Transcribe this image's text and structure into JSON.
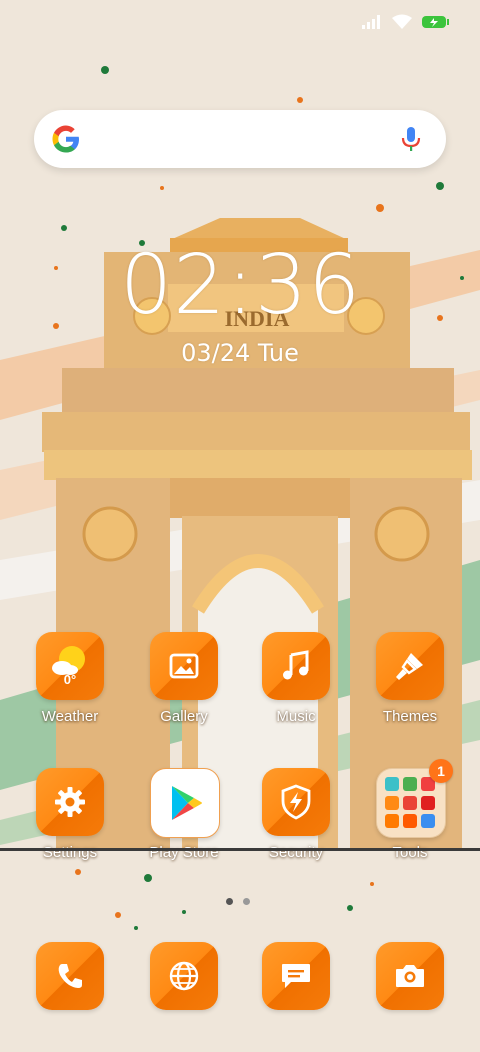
{
  "wallpaper": {
    "monument_text": "INDIA"
  },
  "status_bar": {
    "signal_icon": "signal-icon",
    "wifi_icon": "wifi-icon",
    "battery_icon": "battery-charging-icon",
    "battery_color": "#3cc43c"
  },
  "search": {
    "logo_icon": "google-g-icon",
    "mic_icon": "microphone-icon"
  },
  "clock": {
    "time": "02:36",
    "date": "03/24 Tue"
  },
  "apps_row1": [
    {
      "label": "Weather",
      "icon": "weather-sun-cloud-icon",
      "temp": "0°"
    },
    {
      "label": "Gallery",
      "icon": "gallery-image-icon"
    },
    {
      "label": "Music",
      "icon": "music-note-icon"
    },
    {
      "label": "Themes",
      "icon": "paintbrush-icon"
    }
  ],
  "apps_row2": [
    {
      "label": "Settings",
      "icon": "gear-icon"
    },
    {
      "label": "Play Store",
      "icon": "play-store-icon"
    },
    {
      "label": "Security",
      "icon": "shield-bolt-icon"
    },
    {
      "label": "Tools",
      "icon": "folder-icon",
      "badge": "1"
    }
  ],
  "page_indicator": {
    "pages": 2,
    "current": 1
  },
  "dock": [
    {
      "icon": "phone-icon"
    },
    {
      "icon": "browser-globe-icon"
    },
    {
      "icon": "messages-icon"
    },
    {
      "icon": "camera-icon"
    }
  ],
  "accent_color": "#ff8a14"
}
